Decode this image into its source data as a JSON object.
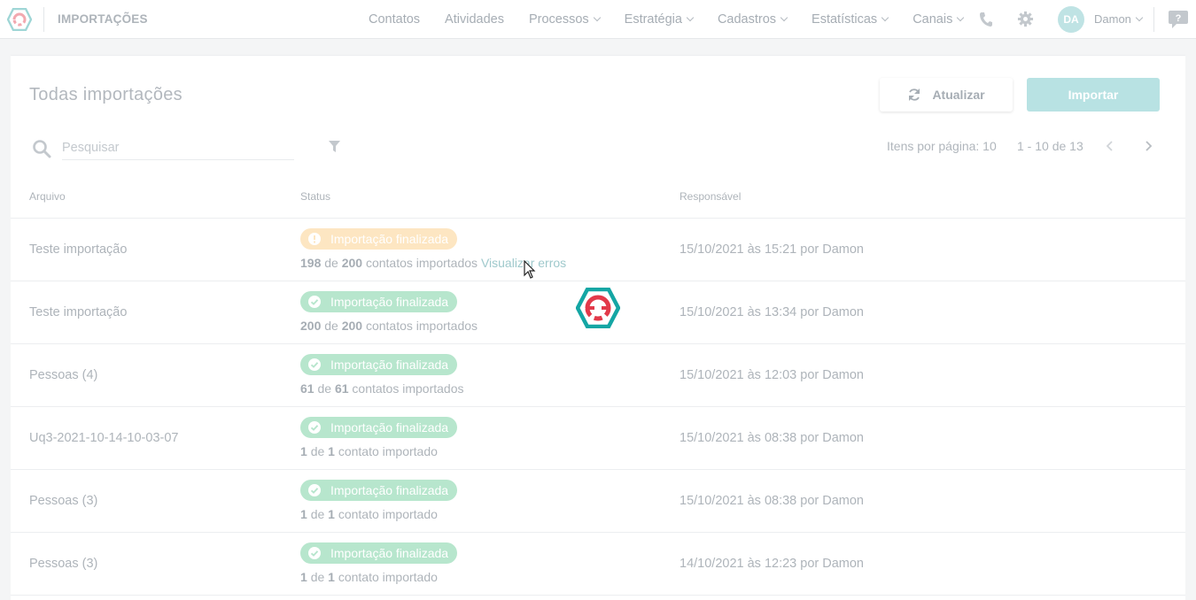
{
  "header": {
    "title": "IMPORTAÇÕES",
    "nav": [
      {
        "label": "Contatos",
        "dropdown": false
      },
      {
        "label": "Atividades",
        "dropdown": false
      },
      {
        "label": "Processos",
        "dropdown": true
      },
      {
        "label": "Estratégia",
        "dropdown": true
      },
      {
        "label": "Cadastros",
        "dropdown": true
      },
      {
        "label": "Estatísticas",
        "dropdown": true
      },
      {
        "label": "Canais",
        "dropdown": true
      }
    ],
    "user": {
      "initials": "DA",
      "name": "Damon"
    },
    "icons": [
      "logo-icon",
      "phone-icon",
      "gear-icon",
      "help-icon"
    ]
  },
  "list": {
    "title": "Todas importações",
    "refresh_label": "Atualizar",
    "import_label": "Importar",
    "search_placeholder": "Pesquisar",
    "per_page": "Itens por página: 10",
    "range": "1 - 10 de 13"
  },
  "table": {
    "columns": [
      "Arquivo",
      "Status",
      "Responsável"
    ],
    "rows": [
      {
        "file": "Teste importação",
        "status": "Importação finalizada",
        "status_type": "warning",
        "imported": "198",
        "total": "200",
        "suffix": "contatos importados",
        "link": "Visualizar erros",
        "responsible": "15/10/2021 às 15:21 por Damon"
      },
      {
        "file": "Teste importação",
        "status": "Importação finalizada",
        "status_type": "success",
        "imported": "200",
        "total": "200",
        "suffix": "contatos importados",
        "link": "",
        "responsible": "15/10/2021 às 13:34 por Damon"
      },
      {
        "file": "Pessoas (4)",
        "status": "Importação finalizada",
        "status_type": "success",
        "imported": "61",
        "total": "61",
        "suffix": "contatos importados",
        "link": "",
        "responsible": "15/10/2021 às 12:03 por Damon"
      },
      {
        "file": "Uq3-2021-10-14-10-03-07",
        "status": "Importação finalizada",
        "status_type": "success",
        "imported": "1",
        "total": "1",
        "suffix": "contato importado",
        "link": "",
        "responsible": "15/10/2021 às 08:38 por Damon"
      },
      {
        "file": "Pessoas (3)",
        "status": "Importação finalizada",
        "status_type": "success",
        "imported": "1",
        "total": "1",
        "suffix": "contato importado",
        "link": "",
        "responsible": "15/10/2021 às 08:38 por Damon"
      },
      {
        "file": "Pessoas (3)",
        "status": "Importação finalizada",
        "status_type": "success",
        "imported": "1",
        "total": "1",
        "suffix": "contato importado",
        "link": "",
        "responsible": "14/10/2021 às 12:23 por Damon"
      }
    ],
    "count_joiner": "de"
  },
  "colors": {
    "accent": "#14a6a4",
    "accent_brand_red": "#e23a4a",
    "success_badge": "#b7e6cd",
    "warning_badge": "#fde6c2"
  }
}
